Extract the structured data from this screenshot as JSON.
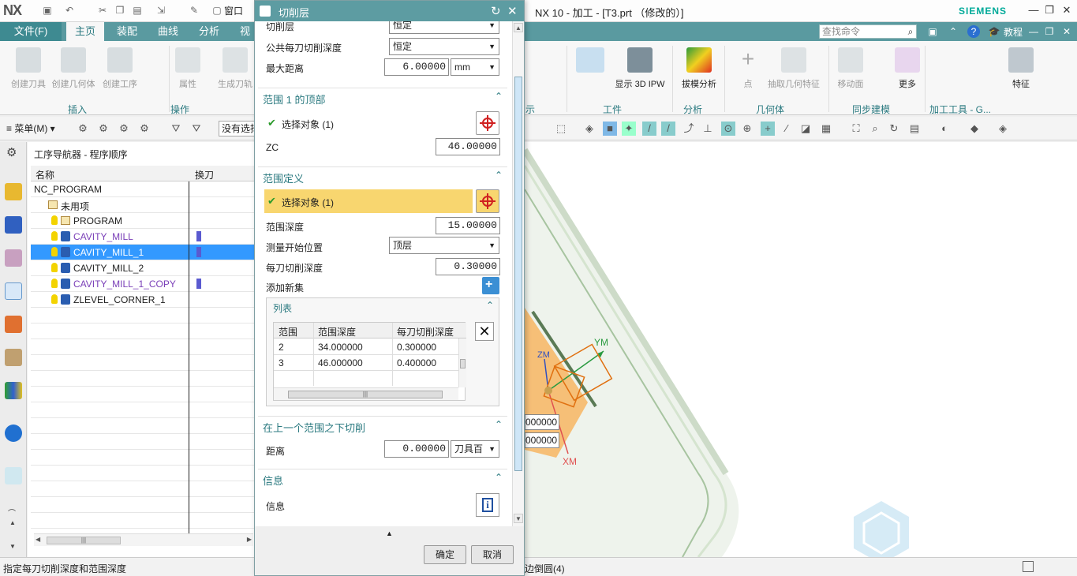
{
  "titlebar": {
    "logo": "NX",
    "window_menu": "窗口",
    "app_title": "NX 10 - 加工 - [T3.prt （修改的）]",
    "brand": "SIEMENS"
  },
  "tabs": {
    "file": "文件(F)",
    "items": [
      "主页",
      "装配",
      "曲线",
      "分析",
      "视"
    ],
    "search_placeholder": "查找命令",
    "tutorial": "教程"
  },
  "ribbon": {
    "create_tool": "创建刀具",
    "create_geometry": "创建几何体",
    "create_operation": "创建工序",
    "properties": "属性",
    "generate_path": "生成刀轨",
    "show_ipw": "显示 3D IPW",
    "draft_analysis": "拔模分析",
    "point": "点",
    "extract_geometry": "抽取几何特征",
    "move_face": "移动面",
    "more": "更多",
    "feature": "特征",
    "groups": {
      "insert": "插入",
      "operation": "操作",
      "show": "示",
      "workpiece": "工件",
      "analysis": "分析",
      "geometry": "几何体",
      "sync_modeling": "同步建模",
      "machining_tools": "加工工具 - G..."
    }
  },
  "cmdrow": {
    "menu": "菜单(M)",
    "filter": "没有选择"
  },
  "navigator": {
    "title": "工序导航器 - 程序顺序",
    "col_name": "名称",
    "col_tool": "换刀",
    "rows": [
      {
        "label": "NC_PROGRAM",
        "type": "root"
      },
      {
        "label": "未用项",
        "type": "folder"
      },
      {
        "label": "PROGRAM",
        "type": "program"
      },
      {
        "label": "CAVITY_MILL",
        "type": "op",
        "purple": true,
        "tool": true
      },
      {
        "label": "CAVITY_MILL_1",
        "type": "op",
        "selected": true,
        "tool": true
      },
      {
        "label": "CAVITY_MILL_2",
        "type": "op"
      },
      {
        "label": "CAVITY_MILL_1_COPY",
        "type": "op",
        "purple": true,
        "tool": true
      },
      {
        "label": "ZLEVEL_CORNER_1",
        "type": "op"
      }
    ]
  },
  "dialog": {
    "title": "切削层",
    "cut_layers_label": "切削层",
    "cut_layers_value": "恒定",
    "common_depth_label": "公共每刀切削深度",
    "common_depth_value": "恒定",
    "max_distance_label": "最大距离",
    "max_distance_value": "6.00000",
    "max_distance_unit": "mm",
    "range1_top": {
      "title": "范围 1 的顶部",
      "select": "选择对象 (1)",
      "zc_label": "ZC",
      "zc_value": "46.00000"
    },
    "range_def": {
      "title": "范围定义",
      "select": "选择对象 (1)",
      "depth_label": "范围深度",
      "depth_value": "15.00000",
      "measure_label": "测量开始位置",
      "measure_value": "顶层",
      "per_cut_label": "每刀切削深度",
      "per_cut_value": "0.30000",
      "add_set": "添加新集"
    },
    "list": {
      "title": "列表",
      "headers": [
        "范围",
        "范围深度",
        "每刀切削深度"
      ],
      "rows": [
        [
          "2",
          "34.000000",
          "0.300000"
        ],
        [
          "3",
          "46.000000",
          "0.400000"
        ]
      ]
    },
    "below": {
      "title": "在上一个范围之下切削",
      "distance_label": "距离",
      "distance_value": "0.00000",
      "distance_unit": "刀具百"
    },
    "info": {
      "title": "信息",
      "label": "信息"
    },
    "ok": "确定",
    "cancel": "取消"
  },
  "viewport": {
    "ym": "YM",
    "xm": "XM",
    "zm": "ZM",
    "coord1": "000000",
    "coord2": "000000"
  },
  "status": {
    "left": "指定每刀切削深度和范围深度",
    "right": "边倒圆(4)"
  }
}
